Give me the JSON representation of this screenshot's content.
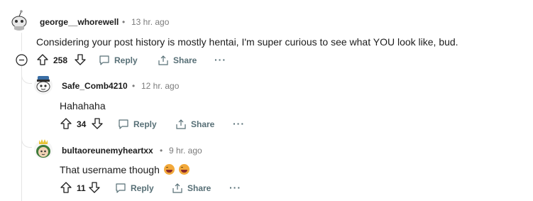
{
  "comments": [
    {
      "author": "george__whorewell",
      "time": "13 hr. ago",
      "text": "Considering your post history is mostly hentai, I'm super curious to see what YOU look like, bud.",
      "score": "258",
      "reply_label": "Reply",
      "share_label": "Share",
      "more_label": "···"
    },
    {
      "author": "Safe_Comb4210",
      "time": "12 hr. ago",
      "text": "Hahahaha",
      "score": "34",
      "reply_label": "Reply",
      "share_label": "Share",
      "more_label": "···"
    },
    {
      "author": "bultaoreunemyheartxx",
      "time": "9 hr. ago",
      "text": "That username though",
      "score": "11",
      "reply_label": "Reply",
      "share_label": "Share",
      "more_label": "···"
    }
  ],
  "separator": "•",
  "colors": {
    "meta": "#7c7c7c",
    "action": "#576f76",
    "line": "#e5e5e5",
    "emoji": "#f2a93b"
  },
  "icons": [
    "upvote-icon",
    "downvote-icon",
    "reply-icon",
    "share-icon",
    "collapse-icon",
    "more-icon",
    "laughing-emoji"
  ]
}
